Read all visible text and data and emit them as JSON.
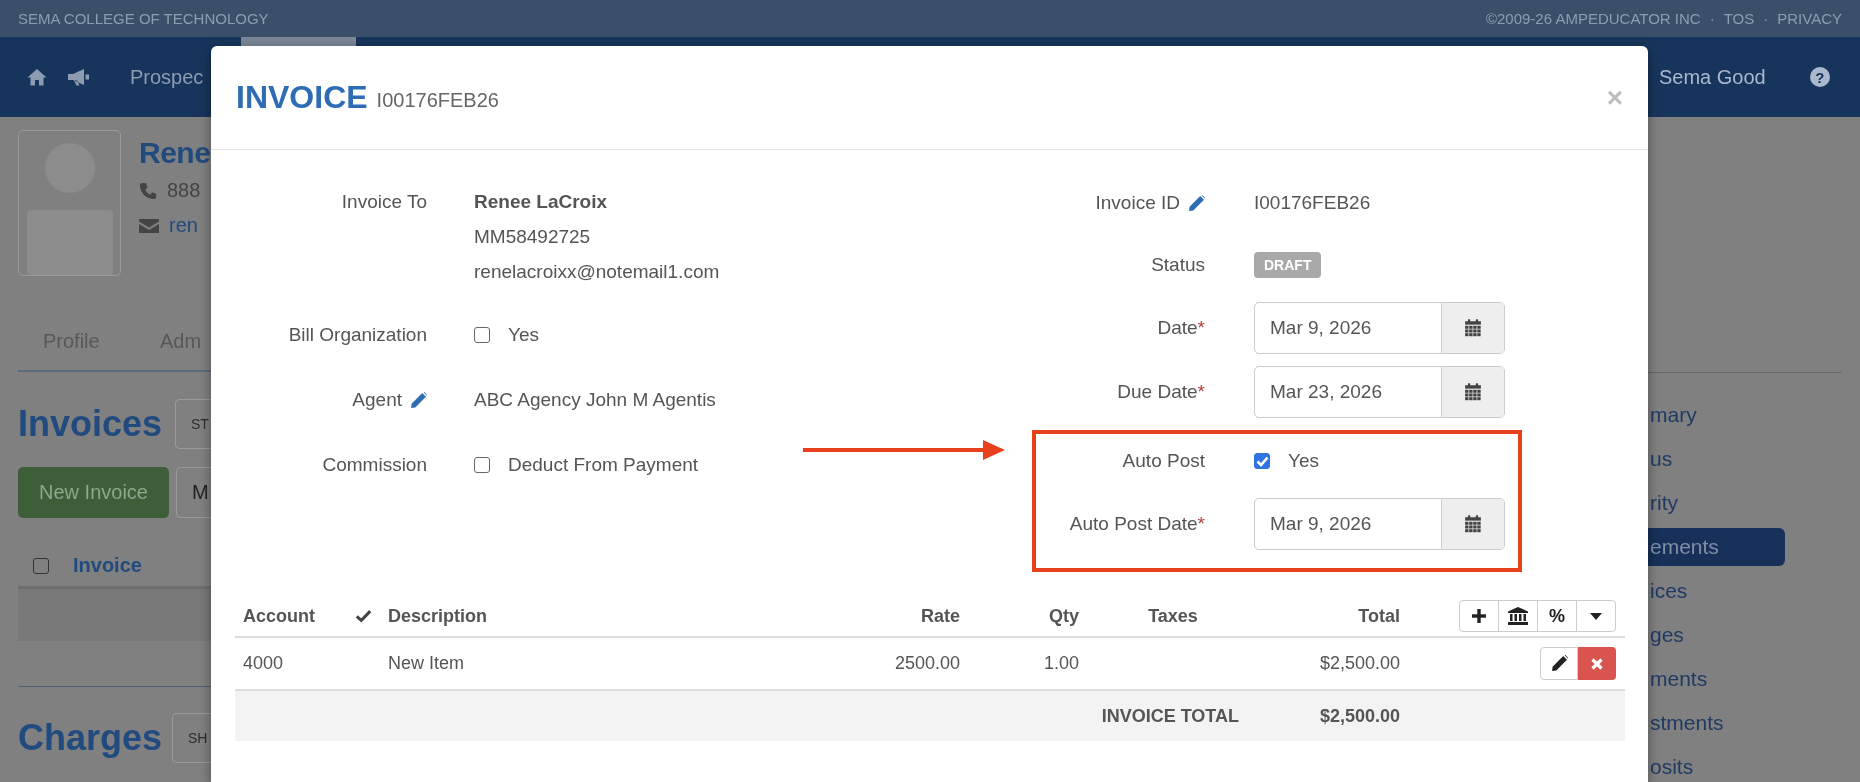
{
  "top_bar": {
    "site": "SEMA COLLEGE OF TECHNOLOGY",
    "links": [
      {
        "label": "©2009-26 AMPEDUCATOR INC"
      },
      {
        "label": "TOS"
      },
      {
        "label": "PRIVACY"
      }
    ],
    "separators": [
      "·",
      "·"
    ]
  },
  "nav": {
    "item": "Prospec",
    "user": "Sema Good",
    "help": "?"
  },
  "profile": {
    "name": "Rene",
    "phone": "888",
    "email": "ren",
    "tabs": [
      {
        "label": "Profile"
      },
      {
        "label": "Adm"
      }
    ]
  },
  "invoices": {
    "title": "Invoices",
    "filter_placeholder": "ST",
    "buttons": [
      {
        "label": "New Invoice",
        "kind": "primary"
      },
      {
        "label": "M",
        "kind": "default"
      }
    ],
    "select_all": {
      "checked": false
    },
    "column": "Invoice"
  },
  "charges": {
    "title": "Charges",
    "filter_placeholder": "SH"
  },
  "side_menu": [
    {
      "label": "mary",
      "selected": false
    },
    {
      "label": "us",
      "selected": false
    },
    {
      "label": "rity",
      "selected": false
    },
    {
      "label": "ements",
      "selected": true
    },
    {
      "label": "ices",
      "selected": false
    },
    {
      "label": "ges",
      "selected": false
    },
    {
      "label": "ments",
      "selected": false
    },
    {
      "label": "stments",
      "selected": false
    },
    {
      "label": "osits",
      "selected": false
    }
  ],
  "modal": {
    "title": "INVOICE",
    "subtitle": "I00176FEB26",
    "close": "×",
    "left_fields": [
      {
        "kind": "contact",
        "label": "Invoice To",
        "name": "Renee LaCroix",
        "lines": [
          "MM58492725",
          "renelacroixx@notemail1.com"
        ]
      },
      {
        "kind": "checkbox",
        "label": "Bill Organization",
        "option": "Yes",
        "checked": false
      },
      {
        "kind": "text",
        "label": "Agent",
        "editable": true,
        "value": "ABC Agency John M Agentis"
      },
      {
        "kind": "checkbox",
        "label": "Commission",
        "option": "Deduct From Payment",
        "checked": false
      }
    ],
    "right_fields": [
      {
        "kind": "text",
        "label": "Invoice ID",
        "editable": true,
        "value": "I00176FEB26"
      },
      {
        "kind": "badge",
        "label": "Status",
        "value": "DRAFT"
      },
      {
        "kind": "date",
        "label": "Date",
        "required_mark": "*",
        "value": "Mar 9, 2026"
      },
      {
        "kind": "date",
        "label": "Due Date",
        "required_mark": "*",
        "value": "Mar 23, 2026"
      }
    ],
    "highlighted_fields": [
      {
        "kind": "checkbox",
        "label": "Auto Post",
        "option": "Yes",
        "checked": true
      },
      {
        "kind": "date",
        "label": "Auto Post Date",
        "required_mark": "*",
        "value": "Mar 9, 2026"
      }
    ],
    "table": {
      "columns": [
        {
          "kind": "text",
          "label": "Account"
        },
        {
          "kind": "icon"
        },
        {
          "kind": "text",
          "label": "Description"
        },
        {
          "kind": "text",
          "label": "Rate"
        },
        {
          "kind": "text",
          "label": "Qty"
        },
        {
          "kind": "text",
          "label": "Taxes"
        },
        {
          "kind": "text",
          "label": "Total"
        }
      ],
      "tools": [
        {
          "kind": "add"
        },
        {
          "kind": "bank"
        },
        {
          "kind": "text",
          "label": "%"
        },
        {
          "kind": "menu"
        }
      ],
      "rows": [
        {
          "account": "4000",
          "description": "New Item",
          "rate": "2500.00",
          "qty": "1.00",
          "total": "$2,500.00"
        }
      ],
      "total": {
        "label": "INVOICE TOTAL",
        "value": "$2,500.00"
      }
    }
  }
}
